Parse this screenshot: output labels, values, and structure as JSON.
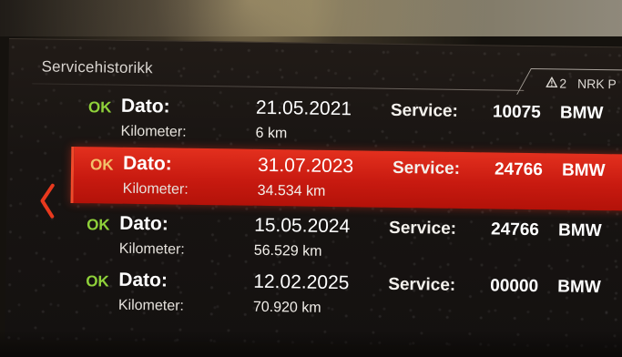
{
  "screen": {
    "title": "Servicehistorikk"
  },
  "status_bar": {
    "warning_icon": "warning-triangle-icon",
    "warning_count": "2",
    "radio_station": "NRK P"
  },
  "navigation": {
    "back_icon": "chevron-left-icon",
    "accent_color": "#e8391e"
  },
  "records": [
    {
      "status": "OK",
      "date_label": "Dato:",
      "date": "21.05.2021",
      "km_label": "Kilometer:",
      "km": "6 km",
      "service_label": "Service:",
      "service_code": "10075",
      "brand": "BMW",
      "selected": false
    },
    {
      "status": "OK",
      "date_label": "Dato:",
      "date": "31.07.2023",
      "km_label": "Kilometer:",
      "km": "34.534 km",
      "service_label": "Service:",
      "service_code": "24766",
      "brand": "BMW",
      "selected": true
    },
    {
      "status": "OK",
      "date_label": "Dato:",
      "date": "15.05.2024",
      "km_label": "Kilometer:",
      "km": "56.529 km",
      "service_label": "Service:",
      "service_code": "24766",
      "brand": "BMW",
      "selected": false
    },
    {
      "status": "OK",
      "date_label": "Dato:",
      "date": "12.02.2025",
      "km_label": "Kilometer:",
      "km": "70.920 km",
      "service_label": "Service:",
      "service_code": "00000",
      "brand": "BMW",
      "selected": false
    }
  ],
  "colors": {
    "ok_green": "#8fd13a",
    "selected_red": "#d42415",
    "text_white": "#ffffff"
  }
}
